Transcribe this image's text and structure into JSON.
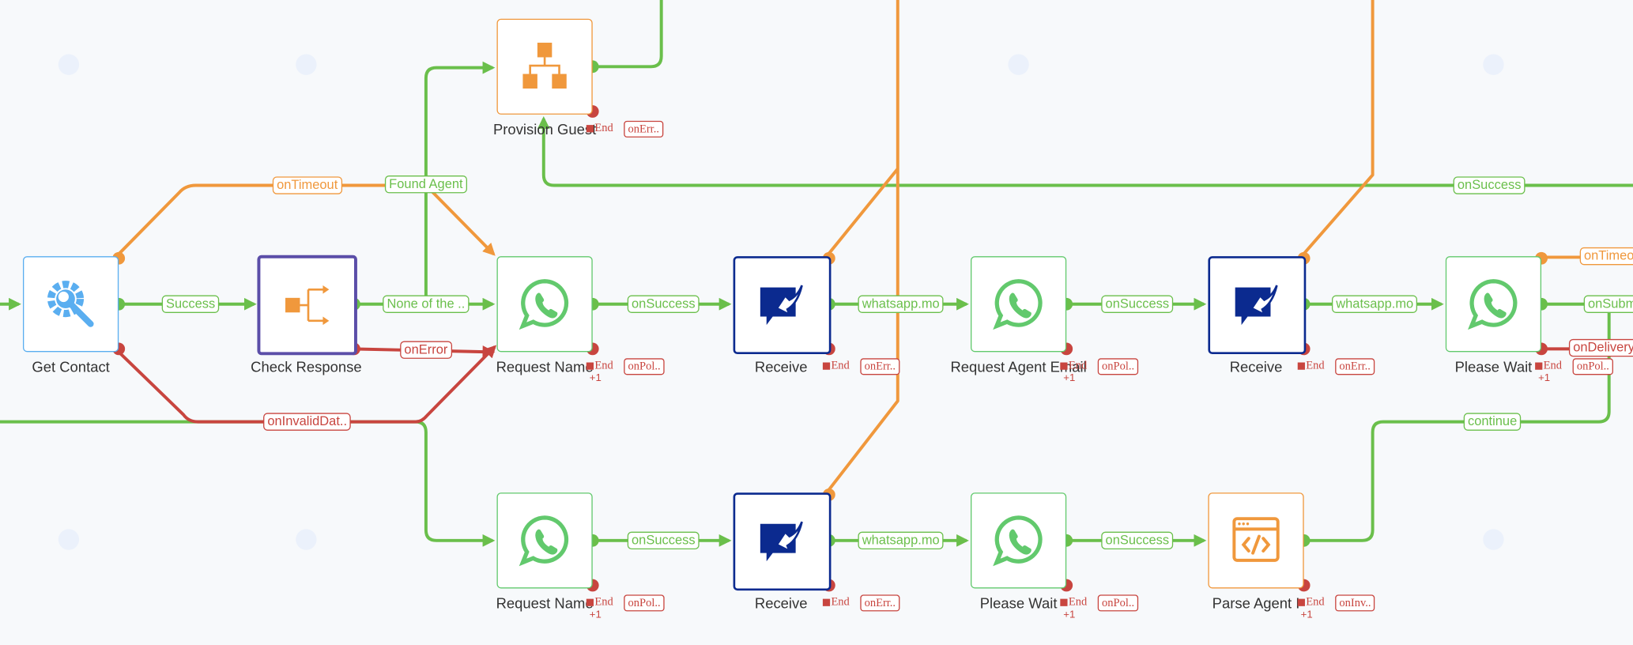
{
  "colors": {
    "success": "#6abf4b",
    "timeout": "#f0983c",
    "error": "#c8453f",
    "receive": "#0b2a8f",
    "whatsapp": "#62c96d",
    "selected": "#5b4ea8",
    "tool": "#5aaef0"
  },
  "nodes": [
    {
      "label": "Get Contact",
      "icon": "gear-wrench-icon"
    },
    {
      "label": "Check Response",
      "icon": "branch-icon"
    },
    {
      "label": "Provision Guest",
      "icon": "org-chart-icon",
      "end": "End",
      "tag": "onErr.."
    },
    {
      "label": "Request Name",
      "icon": "whatsapp-icon",
      "end": "End",
      "tag": "onPol..",
      "plus": "+1"
    },
    {
      "label": "Receive",
      "icon": "receive-message-icon",
      "end": "End",
      "tag": "onErr.."
    },
    {
      "label": "Request Agent Email",
      "icon": "whatsapp-icon",
      "end": "End",
      "tag": "onPol..",
      "plus": "+1"
    },
    {
      "label": "Receive",
      "icon": "receive-message-icon",
      "end": "End",
      "tag": "onErr.."
    },
    {
      "label": "Please Wait",
      "icon": "whatsapp-icon",
      "end": "End",
      "tag": "onPol..",
      "plus": "+1"
    },
    {
      "label": "Request Name",
      "icon": "whatsapp-icon",
      "end": "End",
      "tag": "onPol..",
      "plus": "+1"
    },
    {
      "label": "Receive",
      "icon": "receive-message-icon",
      "end": "End",
      "tag": "onErr.."
    },
    {
      "label": "Please Wait",
      "icon": "whatsapp-icon",
      "end": "End",
      "tag": "onPol..",
      "plus": "+1"
    },
    {
      "label": "Parse Agent I",
      "icon": "code-window-icon",
      "end": "End",
      "tag": "onInv..",
      "plus": "+1"
    }
  ],
  "edges": [
    {
      "label": "Success",
      "kind": "success"
    },
    {
      "label": "None of the ..",
      "kind": "success"
    },
    {
      "label": "Found Agent",
      "kind": "success"
    },
    {
      "label": "onSuccess",
      "kind": "success"
    },
    {
      "label": "onSuccess",
      "kind": "success"
    },
    {
      "label": "whatsapp.mo",
      "kind": "success"
    },
    {
      "label": "onSuccess",
      "kind": "success"
    },
    {
      "label": "whatsapp.mo",
      "kind": "success"
    },
    {
      "label": "onSubm",
      "kind": "success"
    },
    {
      "label": "onSuccess",
      "kind": "success"
    },
    {
      "label": "whatsapp.mo",
      "kind": "success"
    },
    {
      "label": "onSuccess",
      "kind": "success"
    },
    {
      "label": "continue",
      "kind": "success"
    },
    {
      "label": "onTimeout",
      "kind": "timeout"
    },
    {
      "label": "onTimeo",
      "kind": "timeout"
    },
    {
      "label": "onError",
      "kind": "error"
    },
    {
      "label": "onInvalidDat..",
      "kind": "error"
    },
    {
      "label": "onDelivery",
      "kind": "error"
    }
  ]
}
